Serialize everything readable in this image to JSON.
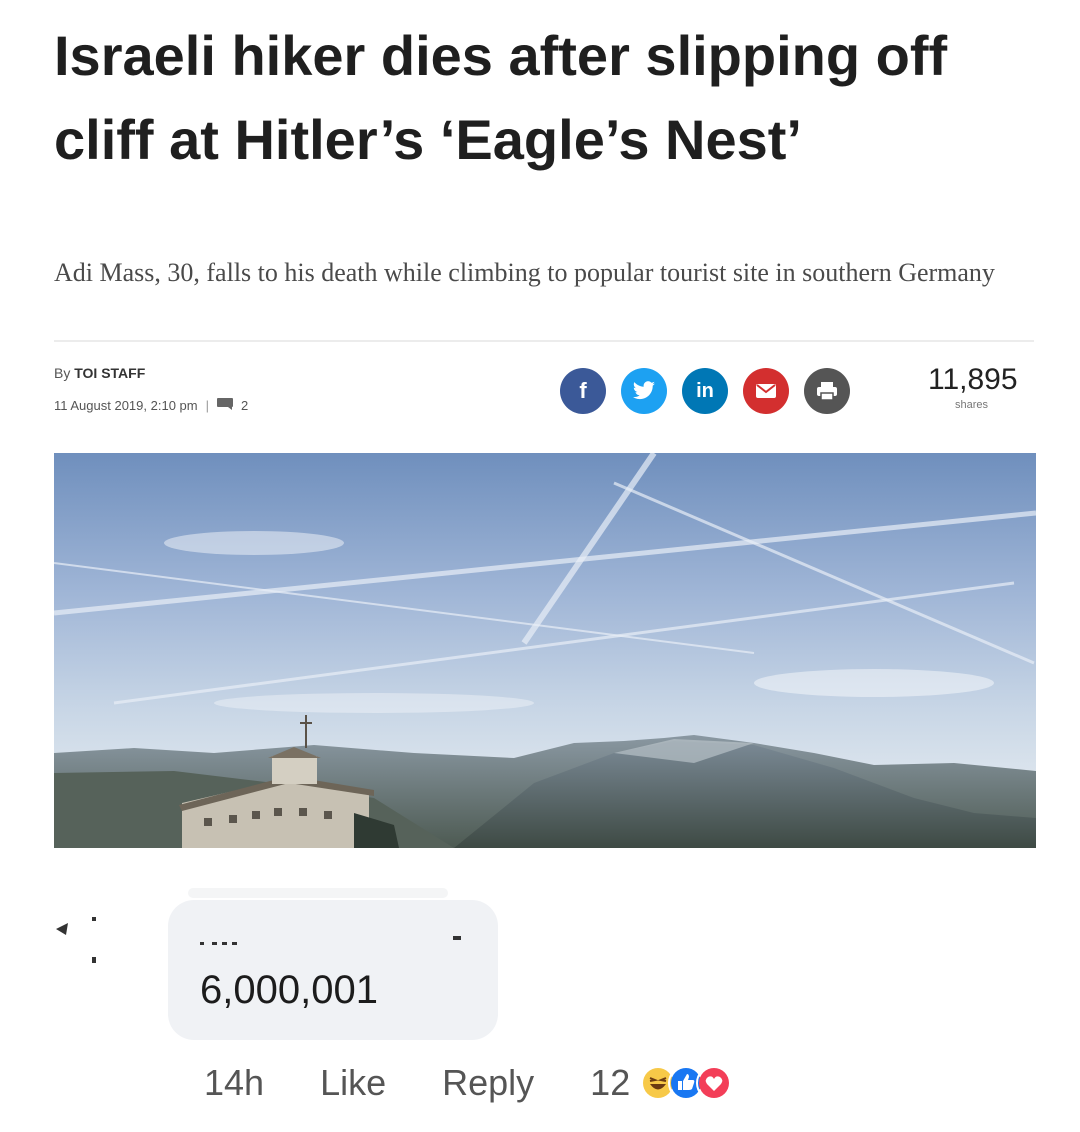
{
  "article": {
    "headline": "Israeli hiker dies after slipping off cliff at Hitler’s ‘Eagle’s Nest’",
    "subheadline": "Adi Mass, 30, falls to his death while climbing to popular tourist site in southern Germany",
    "byline_prefix": "By",
    "byline_author": "TOI STAFF",
    "date": "11 August 2019, 2:10 pm",
    "separator": "|",
    "comment_count": "2",
    "share_count": "11,895",
    "share_label": "shares",
    "share_buttons": [
      {
        "name": "facebook",
        "glyph": "f",
        "color": "#3b5998"
      },
      {
        "name": "twitter",
        "glyph": "",
        "color": "#1da1f2"
      },
      {
        "name": "linkedin",
        "glyph": "in",
        "color": "#0077b5"
      },
      {
        "name": "email",
        "glyph": "",
        "color": "#d32f2f"
      },
      {
        "name": "print",
        "glyph": "",
        "color": "#555555"
      }
    ]
  },
  "comment": {
    "text": "6,000,001",
    "time": "14h",
    "like_label": "Like",
    "reply_label": "Reply",
    "reaction_count": "12",
    "reactions": [
      "haha-icon",
      "like-icon",
      "love-icon"
    ]
  }
}
